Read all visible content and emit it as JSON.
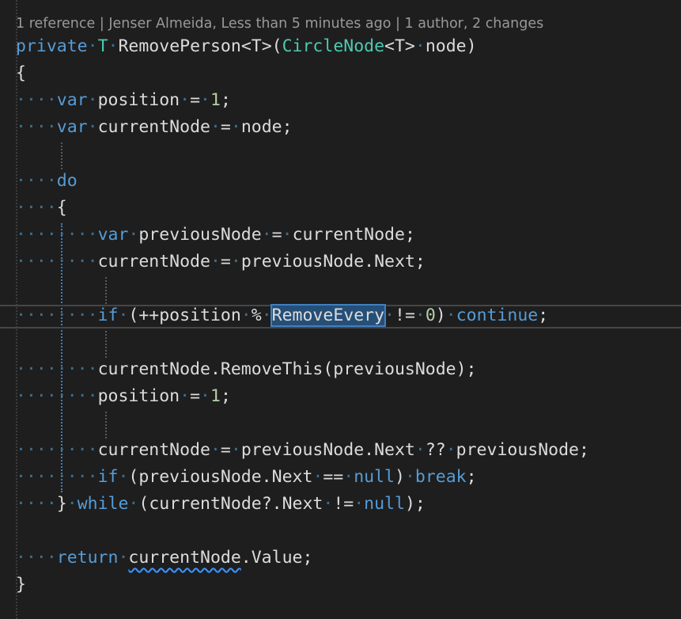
{
  "codelens": {
    "references": "1 reference",
    "author_info": "Jenser Almeida, Less than 5 minutes ago",
    "changes": "1 author, 2 changes",
    "separator": "|"
  },
  "code": {
    "l1": {
      "kw": "private",
      "type_param": "T",
      "name": "RemovePerson",
      "generic_open": "<T>(",
      "param_type": "CircleNode",
      "param_generic": "<T>",
      "param_name": "node)"
    },
    "l2": "{",
    "l3": {
      "kw": "var",
      "name": "position",
      "op": "=",
      "value": "1",
      "end": ";"
    },
    "l4": {
      "kw": "var",
      "name": "currentNode",
      "op": "=",
      "value": "node;"
    },
    "l6": "do",
    "l7": "{",
    "l8": {
      "kw": "var",
      "name": "previousNode",
      "op": "=",
      "value": "currentNode;"
    },
    "l9": {
      "name": "currentNode",
      "op": "=",
      "value": "previousNode.Next;"
    },
    "l11": {
      "kw": "if",
      "open": "(++position",
      "mod": "%",
      "selected": "RemoveEvery",
      "neq": "!=",
      "zero": "0",
      "close": ")",
      "cont": "continue",
      "end": ";"
    },
    "l13": "currentNode.RemoveThis(previousNode);",
    "l14": {
      "name": "position",
      "op": "=",
      "value": "1",
      "end": ";"
    },
    "l16": {
      "name": "currentNode",
      "op": "=",
      "value": "previousNode.Next",
      "coalesce": "??",
      "rhs": "previousNode;"
    },
    "l17": {
      "kw": "if",
      "open": "(previousNode.Next",
      "eq": "==",
      "null": "null",
      "close": ")",
      "brk": "break",
      "end": ";"
    },
    "l18": {
      "brace": "}",
      "kw": "while",
      "open": "(currentNode?.Next",
      "neq": "!=",
      "null": "null",
      "close": ");"
    },
    "l20": {
      "kw": "return",
      "squiggle": "currentNode",
      "rest": ".Value;"
    },
    "l21": "}"
  },
  "colors": {
    "background": "#1e1e1e",
    "keyword": "#569cd6",
    "type": "#4ec9b0",
    "number": "#b5cea8",
    "text": "#dcdcdc",
    "whitespace_dots": "#3f6f8f",
    "selection": "#264f78"
  }
}
